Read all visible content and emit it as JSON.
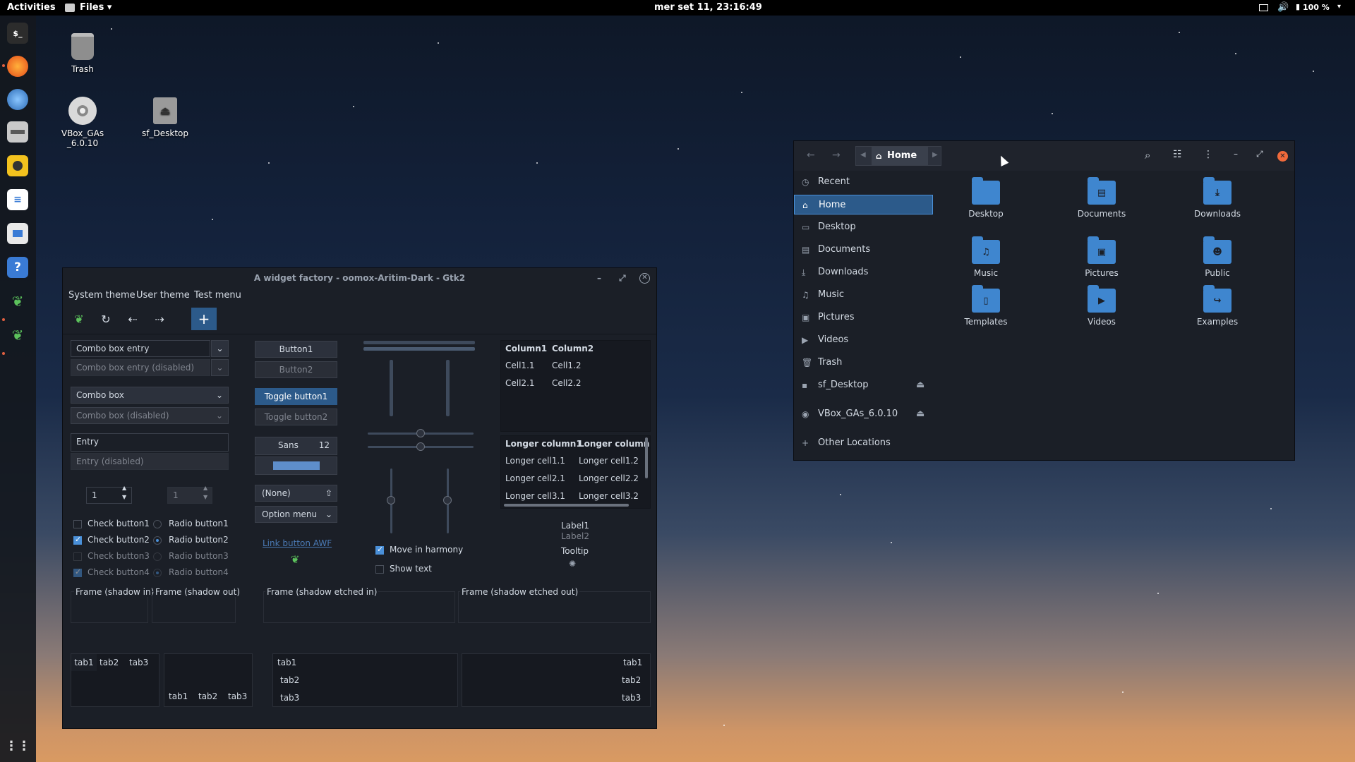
{
  "topbar": {
    "activities": "Activities",
    "app_menu": "Files ▾",
    "clock": "mer set 11, 23:16:49",
    "battery": "100 %"
  },
  "desktop": {
    "icons": [
      {
        "label": "Trash"
      },
      {
        "label": "VBox_GAs_6.0.10"
      },
      {
        "label": "sf_Desktop"
      }
    ]
  },
  "widget_factory": {
    "title": "A widget factory - oomox-Aritim-Dark - Gtk2",
    "menu": [
      "System theme",
      "User theme",
      "Test menu"
    ],
    "combo_entry": "Combo box entry",
    "combo_entry_disabled": "Combo box entry (disabled)",
    "combo_box": "Combo box",
    "combo_box_disabled": "Combo box (disabled)",
    "entry": "Entry",
    "entry_disabled": "Entry (disabled)",
    "spin1": "1",
    "spin2": "1",
    "checks": [
      "Check button1",
      "Check button2",
      "Check button3",
      "Check button4"
    ],
    "radios": [
      "Radio button1",
      "Radio button2",
      "Radio button3",
      "Radio button4"
    ],
    "button1": "Button1",
    "button2": "Button2",
    "toggle1": "Toggle button1",
    "toggle2": "Toggle button2",
    "font_name": "Sans",
    "font_size": "12",
    "file_chooser": "(None)",
    "option_menu": "Option menu",
    "link_button": "Link button AWF",
    "tree1": {
      "headers": [
        "Column1",
        "Column2"
      ],
      "rows": [
        [
          "Cell1.1",
          "Cell1.2"
        ],
        [
          "Cell2.1",
          "Cell2.2"
        ]
      ]
    },
    "tree2": {
      "headers": [
        "Longer column1",
        "Longer column"
      ],
      "rows": [
        [
          "Longer cell1.1",
          "Longer cell1.2"
        ],
        [
          "Longer cell2.1",
          "Longer cell2.2"
        ],
        [
          "Longer cell3.1",
          "Longer cell3.2"
        ]
      ]
    },
    "label1": "Label1",
    "label2": "Label2",
    "tooltip": "Tooltip",
    "move_harmony": "Move in harmony",
    "show_text": "Show text",
    "frames": [
      "Frame (shadow in)",
      "Frame (shadow out)",
      "Frame (shadow etched in)",
      "Frame (shadow etched out)"
    ],
    "tabs": [
      "tab1",
      "tab2",
      "tab3"
    ]
  },
  "files": {
    "path": "Home",
    "sidebar": [
      {
        "label": "Recent",
        "icon": "clock-icon"
      },
      {
        "label": "Home",
        "icon": "home-icon"
      },
      {
        "label": "Desktop",
        "icon": "desktop-icon"
      },
      {
        "label": "Documents",
        "icon": "document-icon"
      },
      {
        "label": "Downloads",
        "icon": "download-icon"
      },
      {
        "label": "Music",
        "icon": "music-icon"
      },
      {
        "label": "Pictures",
        "icon": "picture-icon"
      },
      {
        "label": "Videos",
        "icon": "video-icon"
      },
      {
        "label": "Trash",
        "icon": "trash-icon"
      },
      {
        "label": "sf_Desktop",
        "icon": "drive-icon"
      },
      {
        "label": "VBox_GAs_6.0.10",
        "icon": "disc-icon"
      },
      {
        "label": "Other Locations",
        "icon": "plus-icon"
      }
    ],
    "folders": [
      "Desktop",
      "Documents",
      "Downloads",
      "Music",
      "Pictures",
      "Public",
      "Templates",
      "Videos",
      "Examples"
    ]
  },
  "colors": {
    "accent": "#4a90d9",
    "selection": "#2c5a8a",
    "folder": "#3f86cf"
  }
}
